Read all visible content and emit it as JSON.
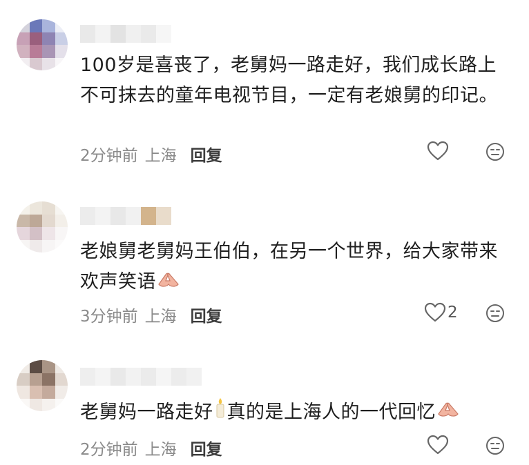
{
  "comments": [
    {
      "content": "100岁是喜丧了，老舅妈一路走好，我们成长路上不可抹去的童年电视节目，一定有老娘舅的印记。",
      "time": "2分钟前",
      "location": "上海",
      "reply_label": "回复",
      "like_count": "",
      "emoji": "",
      "avatar_colors": [
        "#d4d2dc",
        "#6b78b9",
        "#a9b4dc",
        "#eceef6",
        "#c7a1b6",
        "#9a5f7d",
        "#8e84b3",
        "#c9cfe6",
        "#d1b2bf",
        "#b87c97",
        "#a995b5",
        "#e4e0ea",
        "#f2eef1",
        "#d9c9d0",
        "#e8e2e8",
        "#f8f6f8"
      ],
      "name_blocks": [
        "#e9e9e9",
        "#f3f3f3",
        "#e3e3e3",
        "#f0f0f0",
        "#eaeaea",
        "#f6f6f6"
      ]
    },
    {
      "content": "老娘舅老舅妈王伯伯，在另一个世界，给大家带来欢声笑语",
      "time": "3分钟前",
      "location": "上海",
      "reply_label": "回复",
      "like_count": "2",
      "emoji": "folded-hands",
      "avatar_colors": [
        "#f4f1ea",
        "#ece6dc",
        "#e6ded3",
        "#f7f5f1",
        "#c9b8a8",
        "#bda897",
        "#e3d9cf",
        "#f3efe9",
        "#e5d6dc",
        "#d3c0c6",
        "#eee5e8",
        "#f8f6f6",
        "#f7f5f4",
        "#efeaea",
        "#f7f5f5",
        "#fbfafa"
      ],
      "name_blocks": [
        "#ececec",
        "#f3f3f3",
        "#e8e8e8",
        "#f1f1f1",
        "#d3b48c",
        "#e9dccb"
      ]
    },
    {
      "content": "老舅妈一路走好真的是上海人的一代回忆",
      "time": "2分钟前",
      "location": "上海",
      "reply_label": "回复",
      "like_count": "",
      "emoji": "candle+folded-hands",
      "avatar_colors": [
        "#f0ebe6",
        "#5c4c44",
        "#a99485",
        "#eee9e4",
        "#d8cdc4",
        "#b7a091",
        "#8b7365",
        "#e2d8d0",
        "#efe7e1",
        "#d9bfb1",
        "#c4aa9c",
        "#f1ece8",
        "#faf8f6",
        "#efe8e3",
        "#f5f1ee",
        "#fbfaf9"
      ],
      "name_blocks": [
        "#eeeeee",
        "#f4f4f4",
        "#e9e9e9",
        "#f2f2f2",
        "#ebebeb",
        "#f5f5f5",
        "#ececec",
        "#f1f1f1"
      ]
    }
  ],
  "icons": {
    "like": "heart-outline-icon",
    "dislike": "neutral-face-icon",
    "emoji_hands": "folded-hands-icon",
    "emoji_candle": "candle-icon"
  },
  "colors": {
    "text": "#1f1f1f",
    "meta": "#8a8a8a",
    "reply": "#3c3c3c",
    "icon": "#666666",
    "emoji_hands": "#f2b4a0"
  }
}
